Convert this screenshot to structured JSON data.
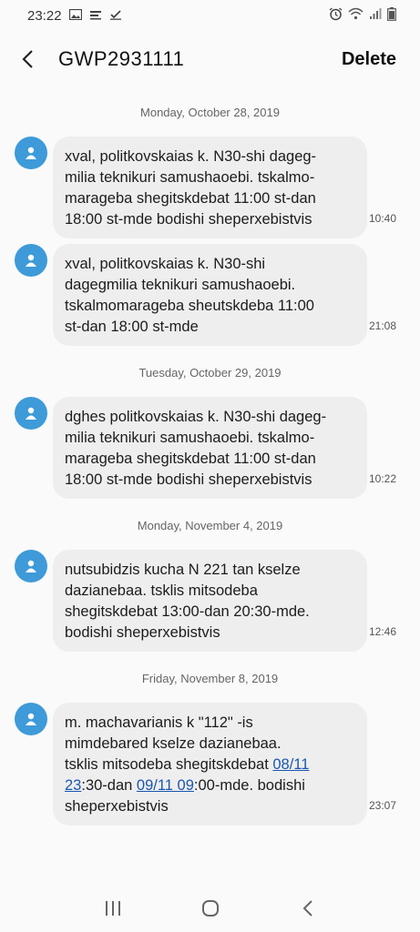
{
  "status_bar": {
    "time": "23:22"
  },
  "header": {
    "title": "GWP2931111",
    "delete_label": "Delete"
  },
  "dates": [
    "Monday, October 28, 2019",
    "Tuesday, October 29, 2019",
    "Monday, November 4, 2019",
    "Friday, November 8, 2019"
  ],
  "messages": [
    {
      "lines": [
        "xval, politkovskaias k. N30-shi dageg-",
        "milia teknikuri samushaoebi. tskalmo-",
        "marageba shegitskdebat 11:00 st-dan",
        "18:00 st-mde bodishi sheperxebistvis"
      ],
      "time": "10:40"
    },
    {
      "lines": [
        "xval, politkovskaias k. N30-shi",
        "dagegmilia teknikuri samushaoebi.",
        "tskalmomarageba sheutskdeba 11:00",
        "st-dan 18:00 st-mde"
      ],
      "time": "21:08"
    },
    {
      "lines": [
        "dghes politkovskaias k. N30-shi dageg-",
        "milia teknikuri samushaoebi. tskalmo-",
        "marageba shegitskdebat 11:00 st-dan",
        "18:00 st-mde bodishi sheperxebistvis"
      ],
      "time": "10:22"
    },
    {
      "lines": [
        "nutsubidzis kucha N 221 tan kselze",
        "dazianebaa. tsklis mitsodeba",
        "shegitskdebat 13:00-dan 20:30-mde.",
        "bodishi sheperxebistvis"
      ],
      "time": "12:46"
    },
    {
      "line1": "m. machavarianis k \"112\" -is",
      "line2": "mimdebared kselze dazianebaa.",
      "line3_text": "tsklis mitsodeba shegitskdebat ",
      "line3_link": "08/11",
      "line4_link1": "23",
      "line4_text1": ":30-dan ",
      "line4_link2": "09/11 09",
      "line4_text2": ":00-mde. bodishi",
      "line5": "sheperxebistvis",
      "time": "23:07"
    }
  ],
  "icons": {
    "back": "chevron-left-icon",
    "avatar": "person-icon",
    "nav_recents": "recents-icon",
    "nav_home": "home-icon",
    "nav_back": "back-nav-icon"
  },
  "colors": {
    "avatar": "#3e9ad8",
    "bubble": "#eeeeee",
    "link": "#1a56b0",
    "background": "#fafafa"
  }
}
